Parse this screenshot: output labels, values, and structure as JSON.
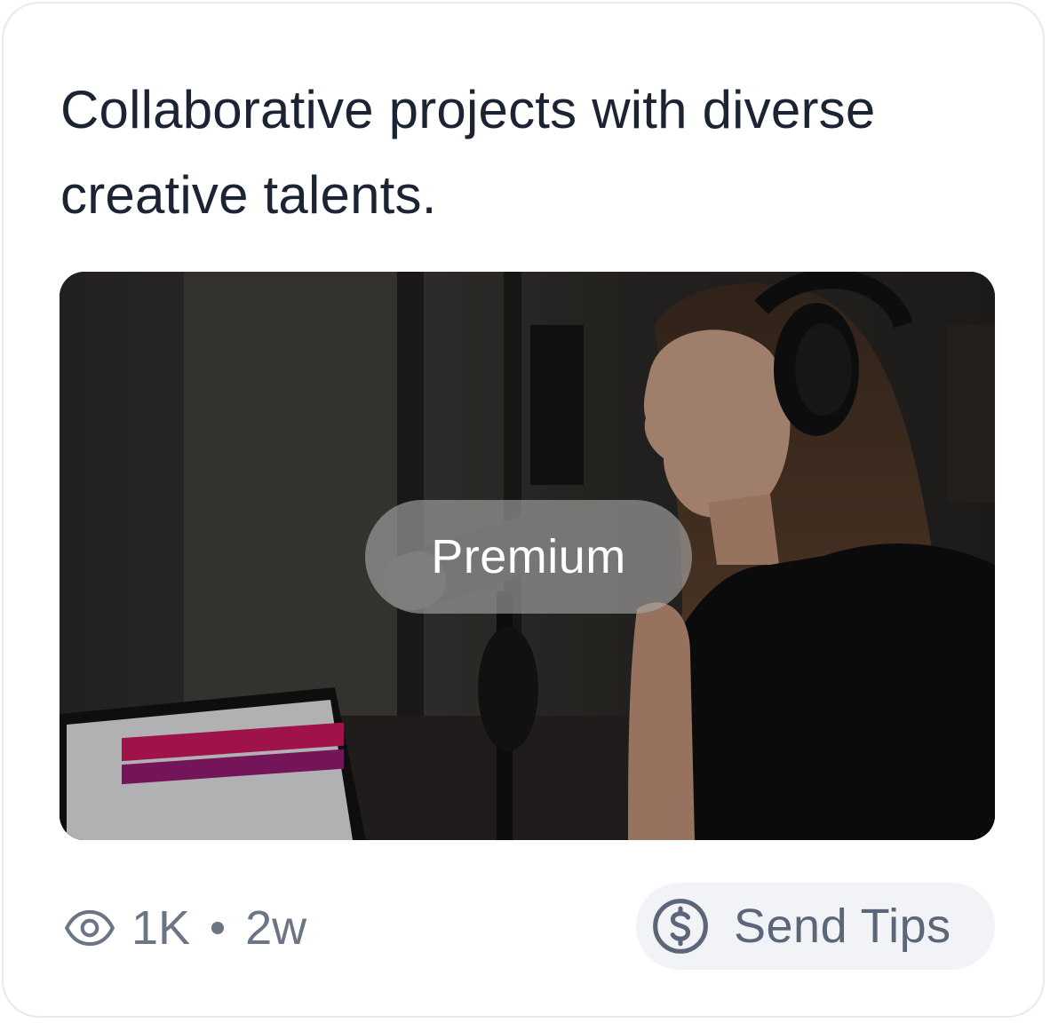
{
  "post": {
    "text": "Collaborative projects with diverse creative talents."
  },
  "media": {
    "badge_label": "Premium"
  },
  "stats": {
    "views": "1K",
    "age": "2w"
  },
  "actions": {
    "send_tips_label": "Send Tips"
  },
  "icons": {
    "views": "eye-icon",
    "tips": "dollar-circle-icon"
  },
  "colors": {
    "text_primary": "#1c2433",
    "text_muted": "#6b7585",
    "button_bg": "#f1f3f6",
    "card_border": "#e6e9ed"
  }
}
